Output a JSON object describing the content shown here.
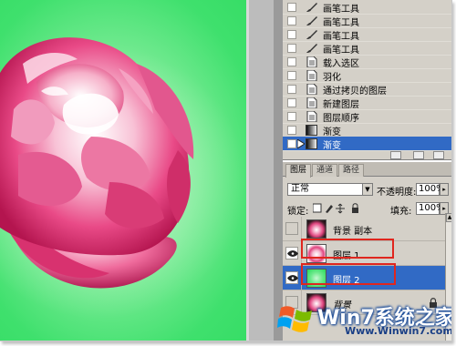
{
  "history": {
    "items": [
      {
        "label": "画笔工具",
        "icon": "brush-icon",
        "selected": false
      },
      {
        "label": "画笔工具",
        "icon": "brush-icon",
        "selected": false
      },
      {
        "label": "画笔工具",
        "icon": "brush-icon",
        "selected": false
      },
      {
        "label": "画笔工具",
        "icon": "brush-icon",
        "selected": false
      },
      {
        "label": "载入选区",
        "icon": "document-icon",
        "selected": false
      },
      {
        "label": "羽化",
        "icon": "document-icon",
        "selected": false
      },
      {
        "label": "通过拷贝的图层",
        "icon": "document-icon",
        "selected": false
      },
      {
        "label": "新建图层",
        "icon": "document-icon",
        "selected": false
      },
      {
        "label": "图层顺序",
        "icon": "document-icon",
        "selected": false
      },
      {
        "label": "渐变",
        "icon": "gradient-icon",
        "selected": false
      },
      {
        "label": "渐变",
        "icon": "gradient-icon",
        "selected": true
      }
    ]
  },
  "layers_panel": {
    "tabs": [
      {
        "label": "图层",
        "active": true
      },
      {
        "label": "通道",
        "active": false
      },
      {
        "label": "路径",
        "active": false
      }
    ],
    "blend_mode": "正常",
    "opacity_label": "不透明度:",
    "opacity_value": "100%",
    "lock_label": "锁定:",
    "fill_label": "填充:",
    "fill_value": "100%",
    "layers": [
      {
        "name": "背景 副本",
        "visible": false,
        "selected": false,
        "thumb": "flower",
        "locked": false
      },
      {
        "name": "图层 1",
        "visible": true,
        "selected": false,
        "thumb": "flower-white",
        "locked": false,
        "highlighted": true
      },
      {
        "name": "图层 2",
        "visible": true,
        "selected": true,
        "thumb": "green-gradient",
        "locked": false,
        "highlighted": true
      },
      {
        "name": "背景",
        "visible": false,
        "selected": false,
        "thumb": "flower",
        "locked": true
      }
    ]
  },
  "watermark": {
    "title": "Win7系统之家",
    "url": "Www.Winwin7.com"
  },
  "colors": {
    "canvas_green": "#3fe06d",
    "selection_blue": "#316ac5",
    "highlight_red": "#e0261e",
    "panel_gray": "#d4d0c8"
  }
}
